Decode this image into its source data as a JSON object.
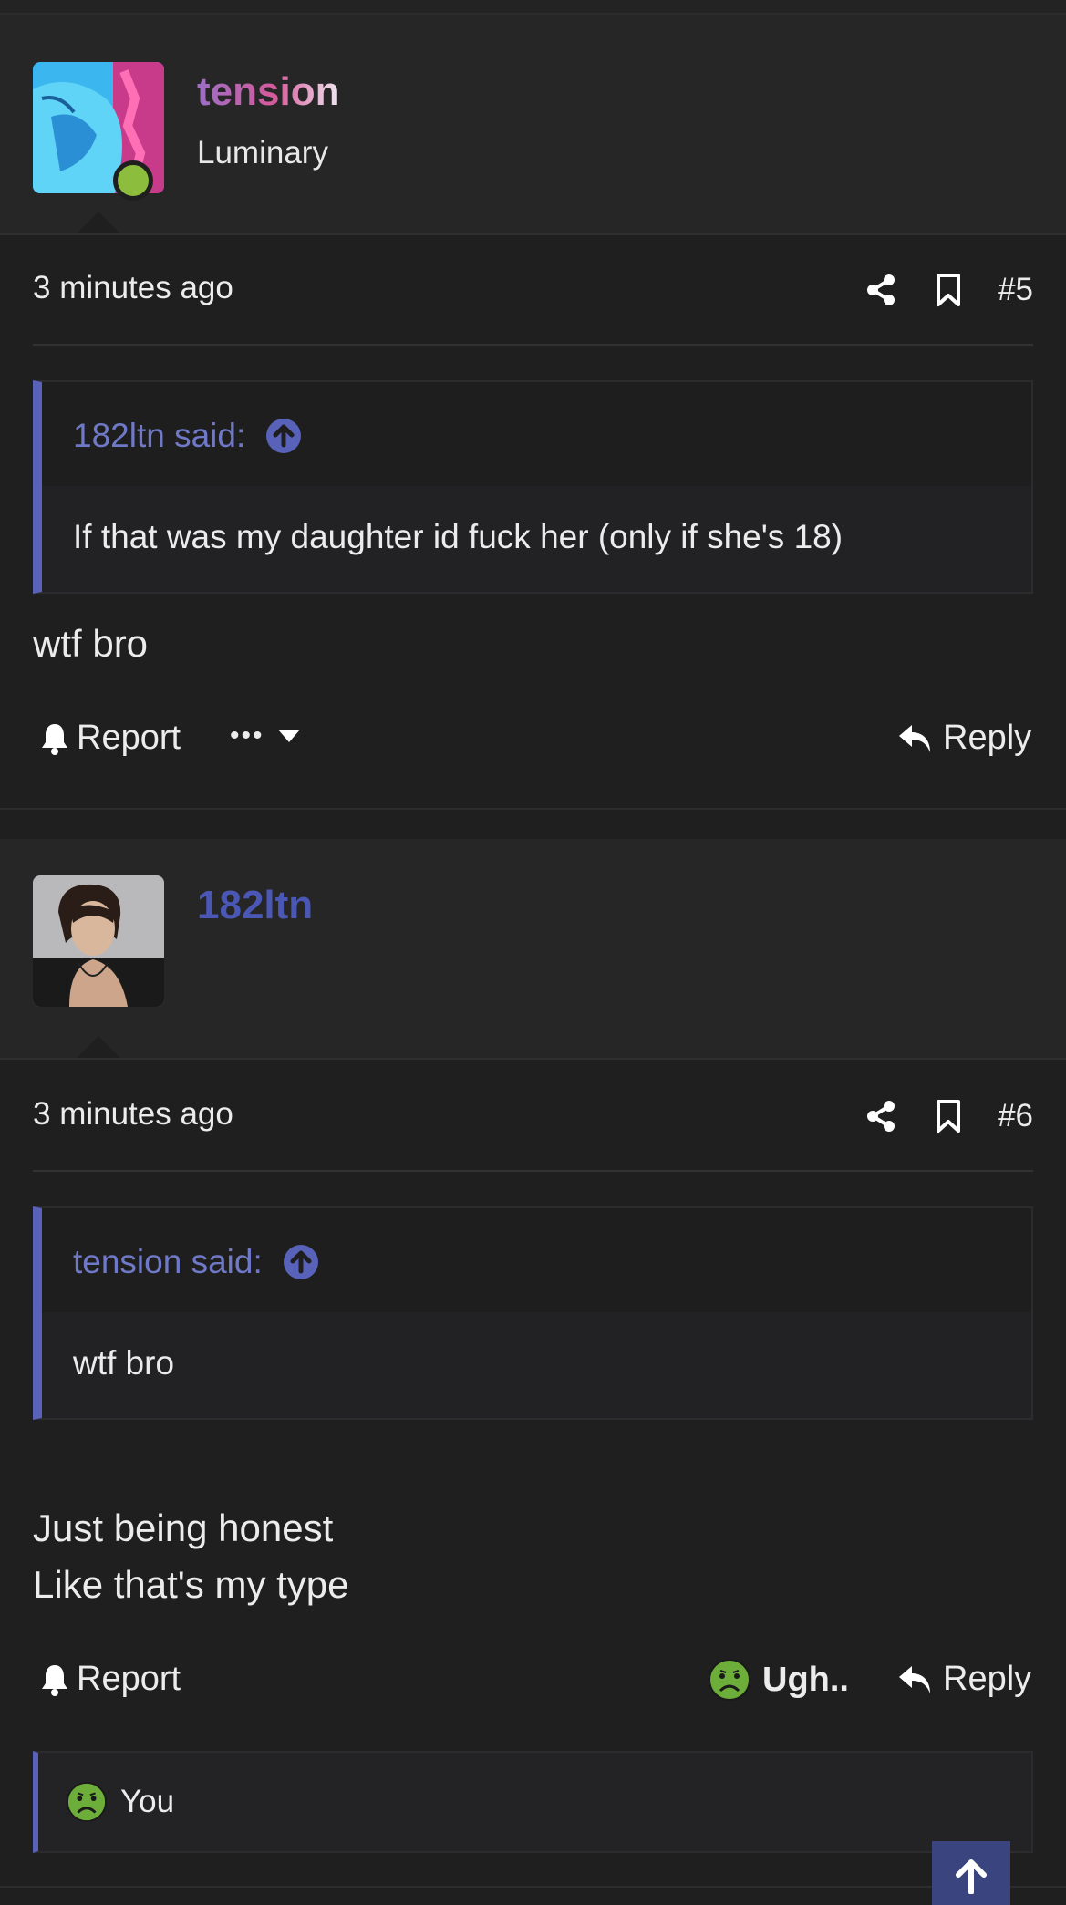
{
  "posts": [
    {
      "username": "tension",
      "user_title": "Luminary",
      "online": true,
      "time": "3 minutes ago",
      "number": "#5",
      "quote": {
        "author": "182ltn said:",
        "text": "If that was my daughter id fuck her (only if she's 18)"
      },
      "body": [
        "wtf bro"
      ],
      "actions": {
        "report": "Report",
        "more": "•••",
        "reply": "Reply"
      }
    },
    {
      "username": "182ltn",
      "user_title": "",
      "online": false,
      "time": "3 minutes ago",
      "number": "#6",
      "quote": {
        "author": "tension said:",
        "text": "wtf bro"
      },
      "body": [
        "Just being honest",
        "Like that's my type"
      ],
      "actions": {
        "report": "Report",
        "reaction": "Ugh..",
        "reply": "Reply"
      },
      "reaction_list": {
        "user": "You",
        "emoji": "nauseated-face"
      }
    }
  ],
  "colors": {
    "accent": "#5862b8",
    "link": "#6f79c8",
    "username2": "#4a57b5",
    "online": "#8dbd3c",
    "reaction": "#6dae3a"
  }
}
